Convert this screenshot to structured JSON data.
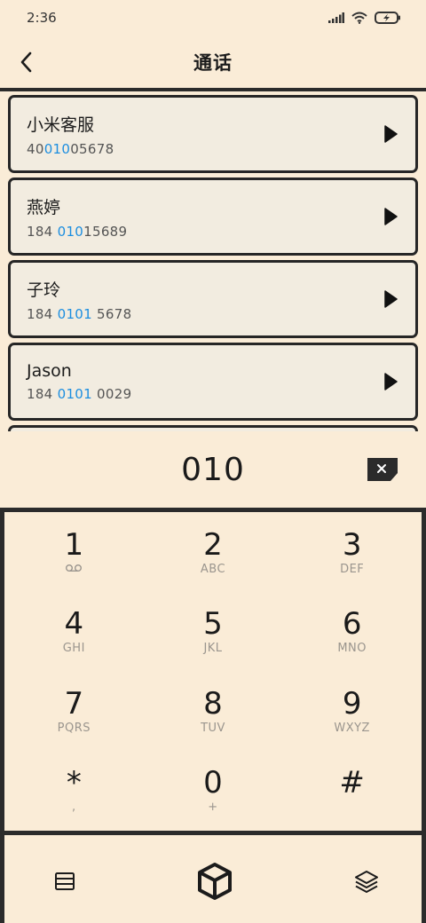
{
  "status_bar": {
    "time": "2:36"
  },
  "header": {
    "title": "通话"
  },
  "contacts": [
    {
      "name": "小米客服",
      "number_pre": "40",
      "number_hl": "010",
      "number_post": "05678"
    },
    {
      "name": "燕婷",
      "number_pre": "184 ",
      "number_hl": "010",
      "number_post": "15689"
    },
    {
      "name": "子玲",
      "number_pre": "184 ",
      "number_hl": "0101",
      "number_post": " 5678"
    },
    {
      "name": "Jason",
      "number_pre": "184 ",
      "number_hl": "0101",
      "number_post": " 0029"
    }
  ],
  "dial_input": {
    "value": "010"
  },
  "keys": [
    {
      "digit": "1",
      "sub": ""
    },
    {
      "digit": "2",
      "sub": "ABC"
    },
    {
      "digit": "3",
      "sub": "DEF"
    },
    {
      "digit": "4",
      "sub": "GHI"
    },
    {
      "digit": "5",
      "sub": "JKL"
    },
    {
      "digit": "6",
      "sub": "MNO"
    },
    {
      "digit": "7",
      "sub": "PQRS"
    },
    {
      "digit": "8",
      "sub": "TUV"
    },
    {
      "digit": "9",
      "sub": "WXYZ"
    },
    {
      "digit": "*",
      "sub": ","
    },
    {
      "digit": "0",
      "sub": "+"
    },
    {
      "digit": "#",
      "sub": ""
    }
  ],
  "icons": {
    "back": "chevron-left-icon",
    "play": "play-icon",
    "delete": "backspace-icon",
    "voicemail": "voicemail-icon",
    "menu": "menu-icon",
    "cube": "cube-icon",
    "layers": "layers-icon"
  },
  "colors": {
    "background": "#faecd7",
    "card": "#f2ece0",
    "highlight": "#1c8ee0",
    "border": "#262626"
  }
}
